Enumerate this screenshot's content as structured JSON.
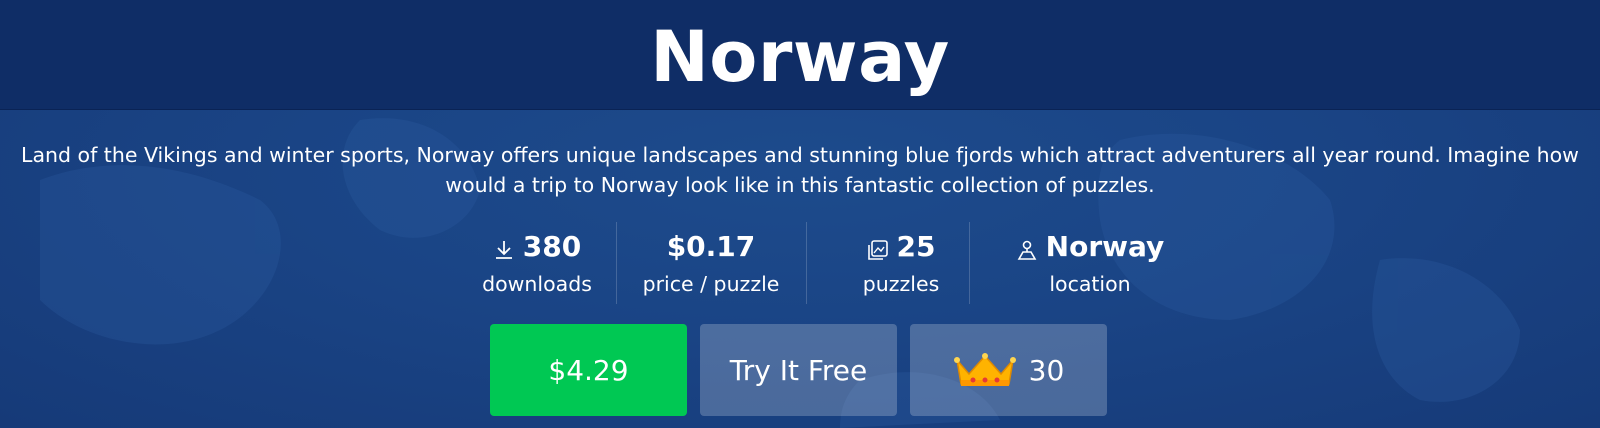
{
  "title": "Norway",
  "description": "Land of the Vikings and winter sports, Norway offers unique landscapes and stunning blue fjords which attract adventurers all year round. Imagine how would a trip to Norway look like in this fantastic collection of puzzles.",
  "stats": [
    {
      "icon": "download-icon",
      "value": "380",
      "label": "downloads"
    },
    {
      "icon": "",
      "value": "$0.17",
      "label": "price / puzzle"
    },
    {
      "icon": "puzzles-icon",
      "value": "25",
      "label": "puzzles"
    },
    {
      "icon": "location-icon",
      "value": "Norway",
      "label": "location"
    }
  ],
  "buttons": {
    "buy_label": "$4.29",
    "try_label": "Try It Free",
    "crown_value": "30",
    "crown_icon": "crown-icon"
  },
  "colors": {
    "header_bg": "#0f2d66",
    "page_bg": "#1a4485",
    "buy_button": "#00c853",
    "secondary_button": "rgba(255,255,255,0.22)"
  }
}
